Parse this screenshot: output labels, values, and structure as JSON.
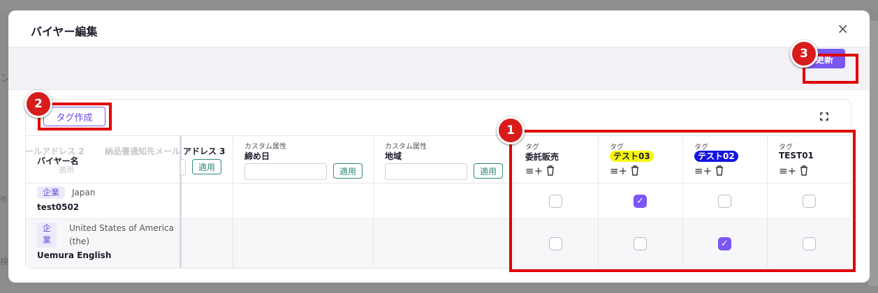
{
  "modal": {
    "title": "バイヤー編集",
    "close_glyph": "×"
  },
  "toolbar": {
    "update_label": "更新"
  },
  "actions": {
    "create_tag_label": "タグ作成"
  },
  "badges": [
    "1",
    "2",
    "3"
  ],
  "table": {
    "ghost_headers": [
      "ールアドレス 2",
      "納品書通知先メール"
    ],
    "buyer_name_header": "バイヤー名",
    "ghost_button": "適用",
    "address3_header": "アドレス 3",
    "apply_label": "適用",
    "custom_attr_label": "カスタム属性",
    "custom_cols": [
      "締め日",
      "地域"
    ],
    "tag_label": "タグ",
    "tag_cols": [
      {
        "name": "委託販売",
        "chip": false,
        "chip_color": "",
        "text_color": "#1d1d2b"
      },
      {
        "name": "テスト03",
        "chip": true,
        "chip_color": "#f5f512",
        "text_color": "#1d1d2b"
      },
      {
        "name": "テスト02",
        "chip": true,
        "chip_color": "#1414e0",
        "text_color": "#ffffff"
      },
      {
        "name": "TEST01",
        "chip": false,
        "chip_color": "",
        "text_color": "#1d1d2b"
      }
    ],
    "rows": [
      {
        "type": "企業",
        "country": "Japan",
        "name": "test0502",
        "checks": [
          false,
          true,
          false,
          false
        ]
      },
      {
        "type": "企業",
        "type_chars": [
          "企",
          "業"
        ],
        "country_lines": [
          "United States of America",
          "(the)"
        ],
        "name": "Uemura English",
        "checks": [
          false,
          false,
          true,
          false
        ]
      }
    ]
  },
  "background": {
    "left_chars": [
      "ン",
      "件",
      "検"
    ]
  },
  "icons": {
    "add_list": "playlist-add-icon",
    "trash": "trash-icon",
    "expand": "expand-icon",
    "check": "check-icon"
  }
}
